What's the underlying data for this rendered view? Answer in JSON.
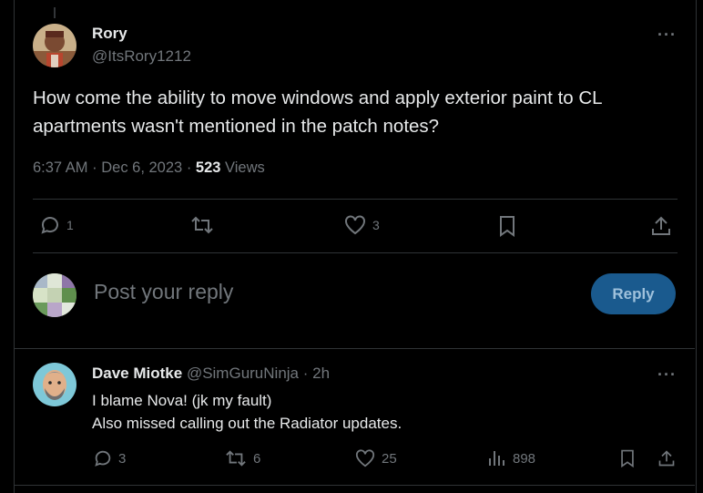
{
  "post": {
    "author_name": "Rory",
    "author_handle": "@ItsRory1212",
    "text": "How come the ability to move windows and apply exterior paint to CL apartments wasn't mentioned in the patch notes?",
    "time": "6:37 AM",
    "date": "Dec 6, 2023",
    "views_count": "523",
    "views_label": "Views",
    "replies": "1",
    "likes": "3"
  },
  "composer": {
    "placeholder": "Post your reply",
    "reply_button": "Reply"
  },
  "reply": {
    "author_name": "Dave Miotke",
    "author_handle": "@SimGuruNinja",
    "time": "2h",
    "line1": "I blame Nova! (jk my fault)",
    "line2": "Also missed calling out the Radiator updates.",
    "replies": "3",
    "reposts": "6",
    "likes": "25",
    "views": "898"
  },
  "icons": [
    "reply-icon",
    "repost-icon",
    "like-icon",
    "bookmark-icon",
    "share-icon",
    "views-icon",
    "more-icon"
  ],
  "colors": {
    "background": "#000000",
    "text": "#e7e9ea",
    "muted": "#71767b",
    "border": "#2f3336",
    "accent_button": "#1a5a8e"
  }
}
